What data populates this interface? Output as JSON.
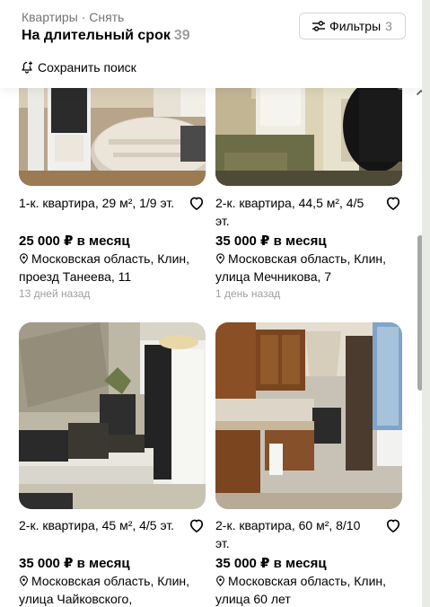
{
  "header": {
    "breadcrumb": "Квартиры · Снять",
    "title": "На длительный срок",
    "title_count": "39",
    "filters_label": "Фильтры",
    "filters_count": "3",
    "save_search_label": "Сохранить поиск"
  },
  "listings": [
    {
      "title": "1-к. квартира, 29 м², 1/9 эт.",
      "price": "25 000 ₽ в месяц",
      "address": "Московская область, Клин, проезд Танеева, 11",
      "date": "13 дней назад"
    },
    {
      "title": "2-к. квартира, 44,5 м², 4/5 эт.",
      "price": "35 000 ₽ в месяц",
      "address": "Московская область, Клин, улица Мечникова, 7",
      "date": "1 день назад"
    },
    {
      "title": "2-к. квартира, 45 м², 4/5 эт.",
      "price": "35 000 ₽ в месяц",
      "address": "Московская область, Клин, улица Чайковского,",
      "date": ""
    },
    {
      "title": "2-к. квартира, 60 м², 8/10 эт.",
      "price": "35 000 ₽ в месяц",
      "address": "Московская область, Клин, улица 60 лет",
      "date": ""
    }
  ],
  "colors": {
    "text": "#000000",
    "muted": "#757575",
    "count": "#9e9e9e"
  }
}
